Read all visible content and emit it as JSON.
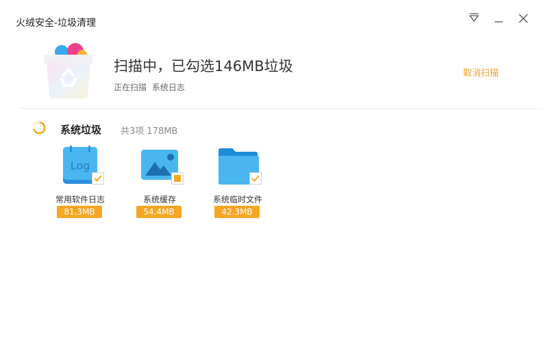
{
  "window": {
    "title": "火绒安全-垃圾清理",
    "colors": {
      "accent": "#f0a020",
      "badge": "#f5a623",
      "blue": "#39a9ea"
    }
  },
  "header": {
    "scan_title": "扫描中，已勾选146MB垃圾",
    "status_label": "正在扫描",
    "status_target": "系统日志",
    "cancel_label": "取消扫描",
    "icon": "recycle-bin-icon"
  },
  "section": {
    "title": "系统垃圾",
    "summary": "共3项 178MB",
    "icon": "loading-spinner-icon"
  },
  "items": [
    {
      "label": "常用软件日志",
      "size": "81.3MB",
      "icon": "log-file-icon",
      "icon_text": "Log",
      "check_state": "checked"
    },
    {
      "label": "系统缓存",
      "size": "54.4MB",
      "icon": "image-cache-icon",
      "check_state": "partial"
    },
    {
      "label": "系统临时文件",
      "size": "42.3MB",
      "icon": "folder-icon",
      "check_state": "checked"
    }
  ]
}
